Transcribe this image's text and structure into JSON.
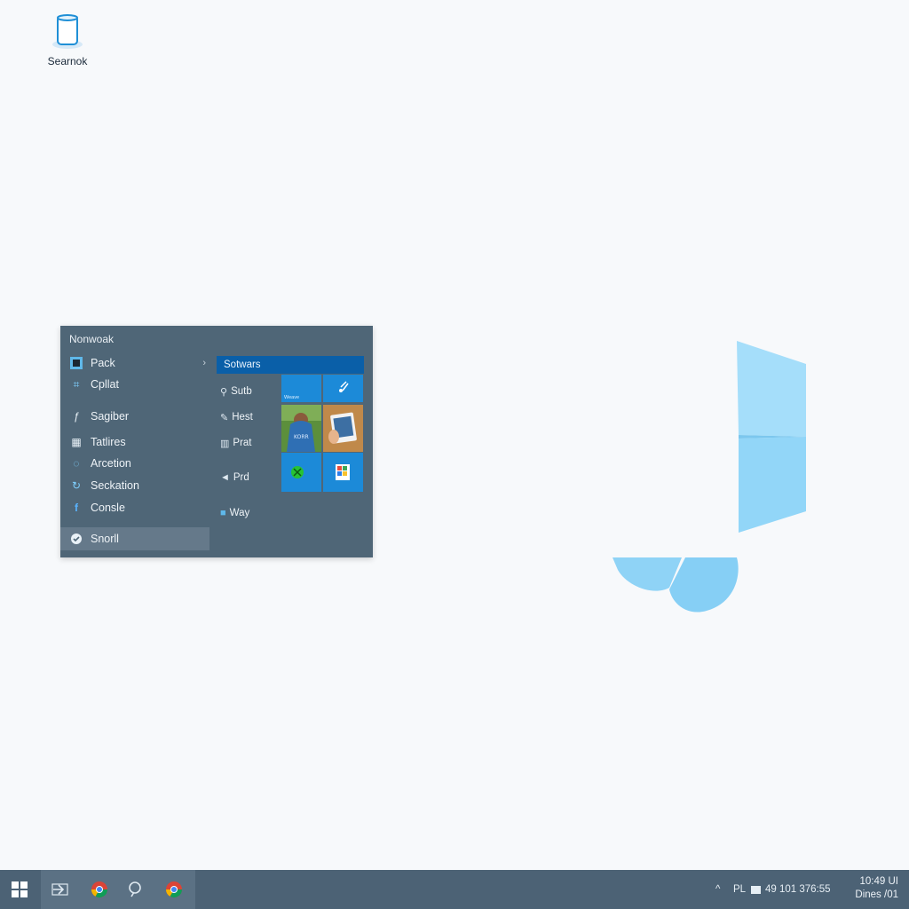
{
  "desktop": {
    "icon_label": "Searnok",
    "icon_name": "cylinder-app-icon"
  },
  "start_menu": {
    "title": "Nonwoak",
    "items": [
      {
        "label": "Pack",
        "icon": "app-square-icon",
        "has_arrow": true
      },
      {
        "label": "Cpllat",
        "icon": "grid-icon"
      },
      {
        "label": "Sagiber",
        "icon": "italic-f-icon"
      },
      {
        "label": "Tatlires",
        "icon": "table-icon"
      },
      {
        "label": "Arcetion",
        "icon": "circle-icon"
      },
      {
        "label": "Seckation",
        "icon": "refresh-icon"
      },
      {
        "label": "Consle",
        "icon": "facebook-icon"
      },
      {
        "label": "Snorll",
        "icon": "check-circle-icon"
      }
    ],
    "header": "Sotwars",
    "sub_items": [
      {
        "label": "Sutb",
        "icon": "pin-icon"
      },
      {
        "label": "Hest",
        "icon": "pencil-icon"
      },
      {
        "label": "Prat",
        "icon": "grid-small-icon"
      },
      {
        "label": "Prd",
        "icon": "send-icon"
      },
      {
        "label": "Way",
        "icon": "bag-icon"
      }
    ],
    "tiles": [
      {
        "label": "Weave",
        "icon": "blank-tile"
      },
      {
        "label": "",
        "icon": "music-note-icon"
      },
      {
        "label": "",
        "icon": "person-photo-tile"
      },
      {
        "label": "",
        "icon": "tablet-photo-tile"
      },
      {
        "label": "",
        "icon": "xbox-icon"
      },
      {
        "label": "",
        "icon": "store-icon"
      }
    ]
  },
  "taskbar": {
    "start_icon": "windows-logo-icon",
    "pinned": [
      "share-icon",
      "chrome-icon",
      "search-person-icon",
      "chrome-icon"
    ],
    "tray": {
      "chevron": "^",
      "lang": "PL",
      "battery": "49 101 376:55",
      "time": "10:49 UI",
      "date": "Dines /01"
    }
  },
  "colors": {
    "menu_bg": "#4f6677",
    "accent": "#0a5fa8",
    "tile": "#1c8ad8",
    "taskbar": "#4c6275",
    "logo": "#8fd3f6"
  }
}
